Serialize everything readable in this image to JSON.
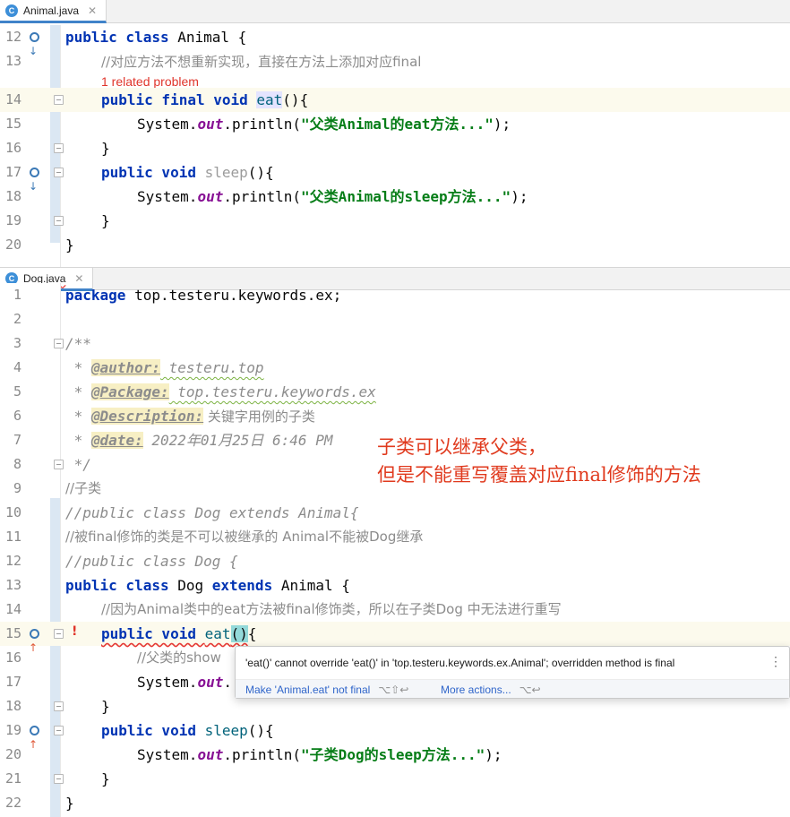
{
  "animal_tab": {
    "icon": "C",
    "name": "Animal.java",
    "close": "✕"
  },
  "dog_tab": {
    "icon": "C",
    "name": "Dog.java",
    "close": "✕"
  },
  "animal": {
    "ln": [
      "12",
      "13",
      "14",
      "15",
      "16",
      "17",
      "18",
      "19",
      "20"
    ],
    "related_problem": "1 related problem",
    "l12_kw": "public class ",
    "l12_rest": "Animal {",
    "l13": "//对应方法不想重新实现，直接在方法上添加对应final",
    "l14_kw": "public final void ",
    "l14_method": "eat",
    "l14_rest": "(){",
    "l15_a": "System.",
    "l15_b": "out",
    "l15_c": ".println(",
    "l15_str": "\"父类Animal的eat方法...\"",
    "l15_d": ");",
    "l16": "}",
    "l17_kw": "public void ",
    "l17_method": "sleep",
    "l17_rest": "(){",
    "l18_a": "System.",
    "l18_b": "out",
    "l18_c": ".println(",
    "l18_str": "\"父类Animal的sleep方法...\"",
    "l18_d": ");",
    "l19": "}",
    "l20": "}"
  },
  "dog": {
    "ln": [
      "1",
      "2",
      "3",
      "4",
      "5",
      "6",
      "7",
      "8",
      "9",
      "10",
      "11",
      "12",
      "13",
      "14",
      "15",
      "16",
      "17",
      "18",
      "19",
      "20",
      "21",
      "22"
    ],
    "l1_kw": "package ",
    "l1_rest": "top.testeru.keywords.ex;",
    "l3": "/**",
    "l4_pre": " * ",
    "l4_tag": "@author:",
    "l4_val": " testeru.top",
    "l5_pre": " * ",
    "l5_tag": "@Package:",
    "l5_val": " top.testeru.keywords.ex",
    "l6_pre": " * ",
    "l6_tag": "@Description:",
    "l6_val": " 关键字用例的子类",
    "l7_pre": " * ",
    "l7_tag": "@date:",
    "l7_val": " 2022年01月25日 6:46 PM",
    "l8": " */",
    "l9": "//子类",
    "l10": "//public class Dog extends Animal{",
    "l11": "//被final修饰的类是不可以被继承的 Animal不能被Dog继承",
    "l12": "//public class Dog {",
    "l13_kw1": "public class ",
    "l13_name": "Dog ",
    "l13_kw2": "extends ",
    "l13_rest": "Animal {",
    "l14": "//因为Animal类中的eat方法被final修饰类，所以在子类Dog 中无法进行重写",
    "l15_kw": "public void ",
    "l15_method": "eat",
    "l15_paren": "()",
    "l15_rest": "{",
    "l16": "//父类的show",
    "l17_a": "System.",
    "l17_b": "out",
    "l17_c": ".",
    "l18": "}",
    "l19_kw": "public void ",
    "l19_method": "sleep",
    "l19_rest": "(){",
    "l20_a": "System.",
    "l20_b": "out",
    "l20_c": ".println(",
    "l20_str": "\"子类Dog的sleep方法...\"",
    "l20_d": ");",
    "l21": "}",
    "l22": "}"
  },
  "annotation": "子类可以继承父类，\n但是不能重写覆盖对应final修饰的方法",
  "popup": {
    "message": "'eat()' cannot override 'eat()' in 'top.testeru.keywords.ex.Animal'; overridden method is final",
    "more_icon": "⋮",
    "fix_label": "Make 'Animal.eat' not final",
    "fix_shortcut": "⌥⇧↩",
    "more_label": "More actions...",
    "more_shortcut": "⌥↩"
  },
  "colors": {
    "keyword": "#0033b3",
    "string": "#067d17",
    "comment": "#8c8c8c",
    "static_field": "#871094",
    "error": "#e0352b",
    "annotation": "#e03a1e"
  }
}
